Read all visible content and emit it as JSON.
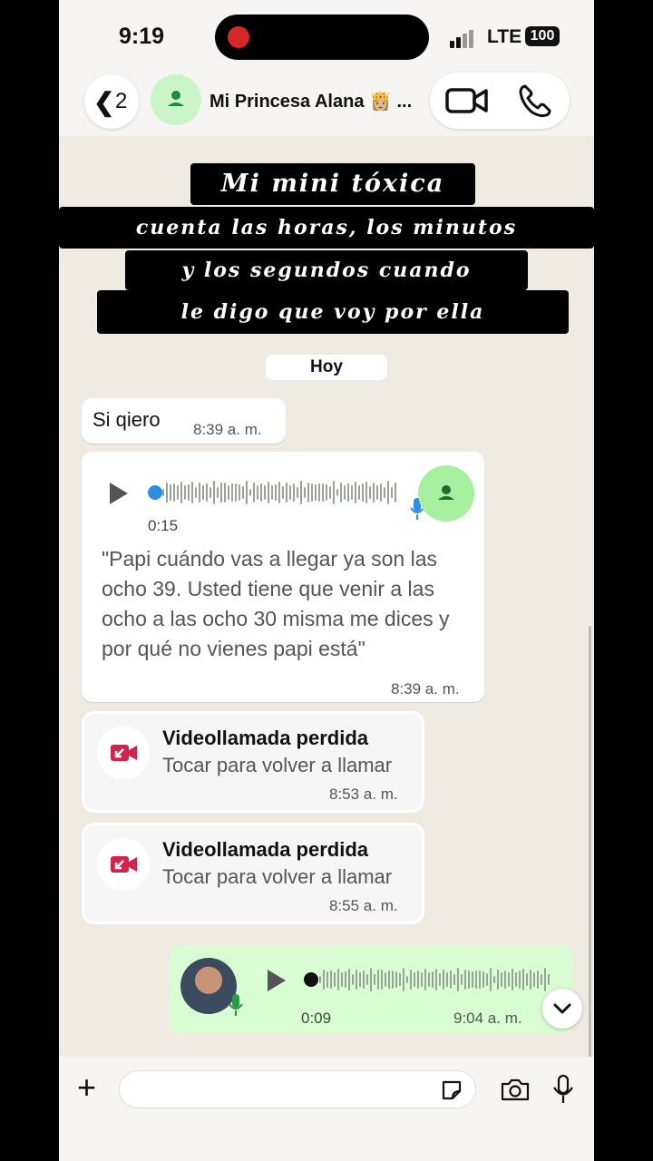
{
  "status_bar": {
    "time": "9:19",
    "network": "LTE",
    "battery": "100"
  },
  "header": {
    "back_count": "2",
    "contact_name": "Mi Princesa Alana 👸🏼 ..."
  },
  "overlay_caption": [
    "Mi mini tóxica",
    "cuenta las horas, los minutos",
    "y los segundos cuando",
    "le digo que voy por ella"
  ],
  "chat": {
    "date_chip": "Hoy",
    "messages": [
      {
        "type": "text",
        "text": "Si qiero",
        "time": "8:39 a. m."
      },
      {
        "type": "voice",
        "duration": "0:15",
        "transcript": "\"Papi cuándo vas a llegar ya son las ocho 39. Usted tiene que venir a las ocho a las ocho 30 misma me dices y por qué no vienes papi está\"",
        "time": "8:39 a. m."
      },
      {
        "type": "missed_call",
        "title": "Videollamada perdida",
        "subtitle": "Tocar para volver a llamar",
        "time": "8:53 a. m."
      },
      {
        "type": "missed_call",
        "title": "Videollamada perdida",
        "subtitle": "Tocar para volver a llamar",
        "time": "8:55 a. m."
      },
      {
        "type": "voice_outgoing",
        "duration": "0:09",
        "time": "9:04 a. m."
      }
    ]
  },
  "input": {
    "placeholder": ""
  },
  "colors": {
    "outgoing_bubble": "#d8fdd2",
    "avatar_green": "#c9f5c9",
    "missed_call_red": "#d1234b",
    "chat_bg": "#efeae2"
  },
  "icons": [
    "back-chevron-icon",
    "contact-avatar-icon",
    "video-call-icon",
    "phone-call-icon",
    "play-icon",
    "mic-icon",
    "missed-video-call-icon",
    "chevron-down-icon",
    "plus-icon",
    "sticker-icon",
    "camera-icon"
  ]
}
